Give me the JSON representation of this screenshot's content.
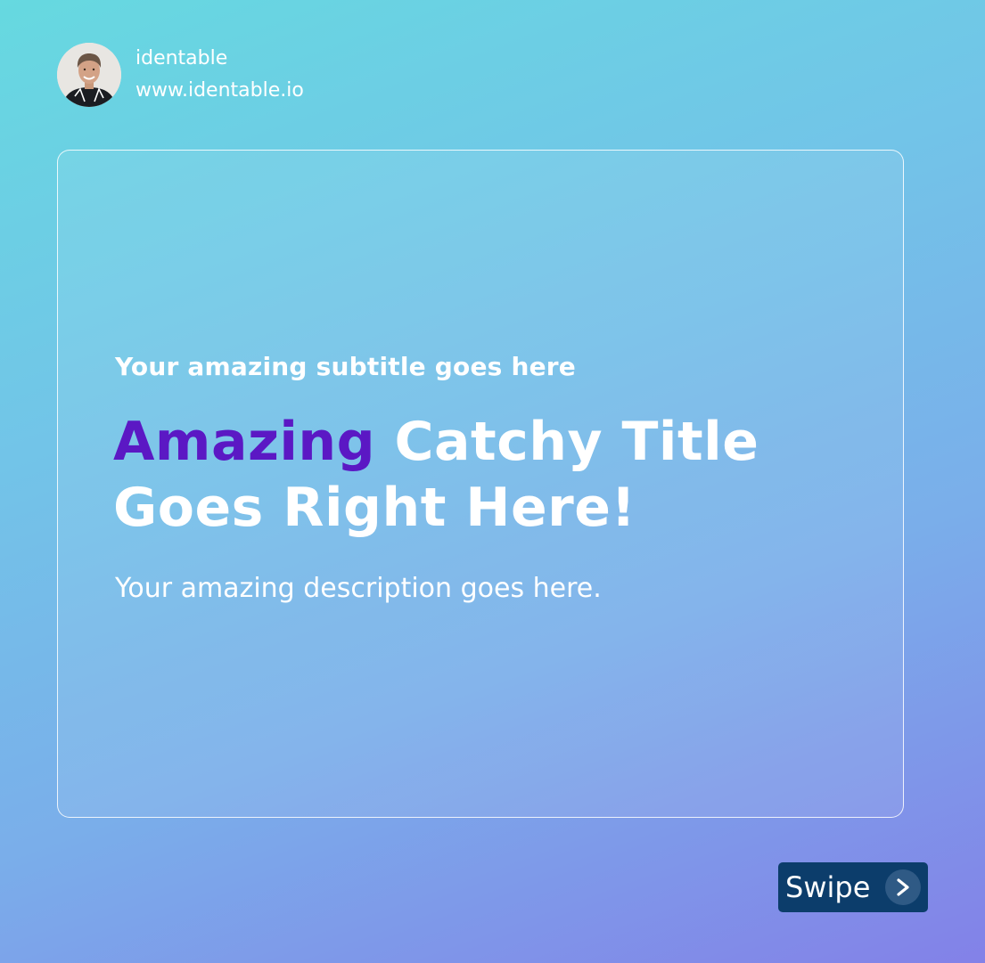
{
  "profile": {
    "name": "identable",
    "website": "www.identable.io"
  },
  "card": {
    "subtitle": "Your amazing subtitle goes here",
    "title_accent": "Amazing",
    "title_rest": " Catchy Title",
    "title_line2": "Goes Right Here!",
    "description": "Your amazing description goes here."
  },
  "swipe": {
    "label": "Swipe",
    "icon": "chevron-right-icon"
  },
  "colors": {
    "gradient_start": "#66d9e0",
    "gradient_end": "#8381e8",
    "accent": "#5b18c4",
    "swipe_button": "#0c3d6b",
    "text": "#ffffff"
  }
}
